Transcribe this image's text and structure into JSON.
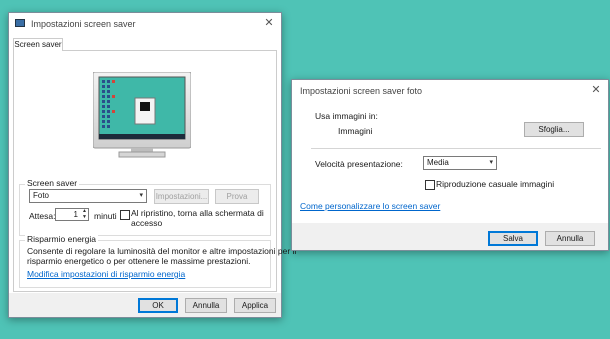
{
  "dialog1": {
    "title": "Impostazioni screen saver",
    "tab": "Screen saver",
    "screensaver_group": "Screen saver",
    "screensaver_selected": "Foto",
    "settings_button": "Impostazioni...",
    "preview_button": "Prova",
    "wait_label": "Attesa:",
    "wait_value": "1",
    "minutes_label": "minuti",
    "resume_checkbox_line1": "Al ripristino, torna alla schermata di",
    "resume_checkbox_line2": "accesso",
    "power_group": "Risparmio energia",
    "power_text_line1": "Consente di regolare la luminosità del monitor e altre impostazioni per il",
    "power_text_line2": "risparmio energetico o per ottenere le massime prestazioni.",
    "power_link": "Modifica impostazioni di risparmio energia",
    "ok_button": "OK",
    "cancel_button": "Annulla",
    "apply_button": "Applica"
  },
  "dialog2": {
    "title": "Impostazioni screen saver foto",
    "use_images_label": "Usa immagini in:",
    "folder_value": "Immagini",
    "browse_button": "Sfoglia...",
    "speed_label": "Velocità presentazione:",
    "speed_selected": "Media",
    "shuffle_label": "Riproduzione casuale immagini",
    "customize_link": "Come personalizzare lo screen saver",
    "save_button": "Salva",
    "cancel_button": "Annulla"
  },
  "colors": {
    "desktop": "#4fc3b6",
    "accent": "#0078d7",
    "link": "#0066cc"
  }
}
